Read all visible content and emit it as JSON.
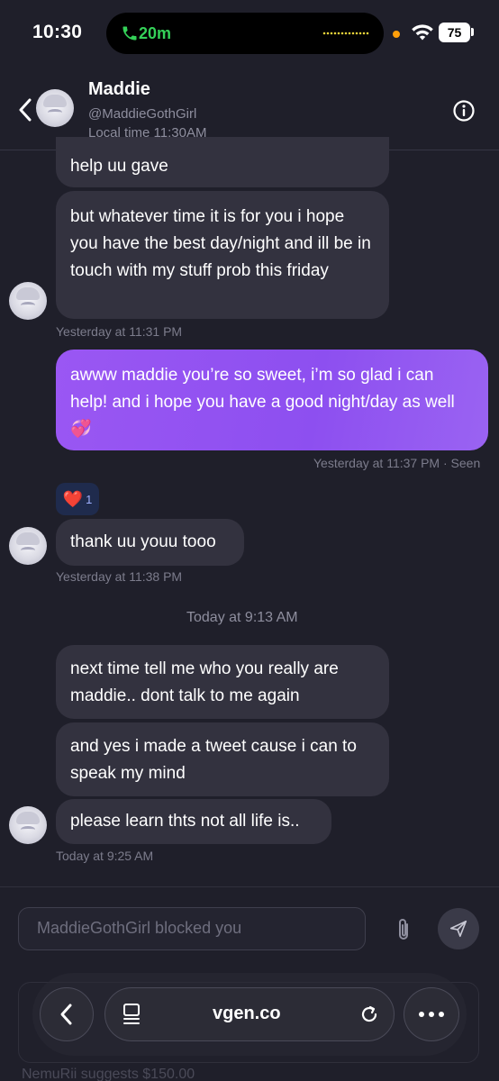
{
  "status_bar": {
    "time": "10:30",
    "call_duration": "20m",
    "battery": "75"
  },
  "header": {
    "name": "Maddie",
    "handle": "@MaddieGothGirl",
    "local_time": "Local time 11:30AM"
  },
  "messages": {
    "m1_partial": "help uu gave",
    "m2": "but whatever time it is for you i hope you have the best day/night and ill be in touch with my stuff prob this friday",
    "m2_meta": "Yesterday at 11:31 PM",
    "m3_out": "awww maddie you’re so sweet, i’m so glad i can help! and i hope you have a good night/day as well 💞",
    "m3_meta": "Yesterday at 11:37 PM · Seen",
    "reaction_emoji": "❤️",
    "reaction_count": "1",
    "m4": "thank uu youu tooo",
    "m4_meta": "Yesterday at 11:38 PM",
    "day_divider": "Today at 9:13 AM",
    "m5": "next time tell me who you really are maddie.. dont talk to me again",
    "m6": "and yes i made a tweet cause i can to speak my mind",
    "m7": "please learn thts not all life is..",
    "m7_meta": "Today at 9:25 AM"
  },
  "composer": {
    "placeholder": "MaddieGothGirl blocked you"
  },
  "browser": {
    "url": "vgen.co"
  },
  "below": {
    "suggest_text": "NemuRii suggests $150.00"
  },
  "colors": {
    "background": "#1f1f2a",
    "incoming_bubble": "#33323f",
    "outgoing_bubble": "#9a57f3",
    "call_green": "#34d158"
  }
}
